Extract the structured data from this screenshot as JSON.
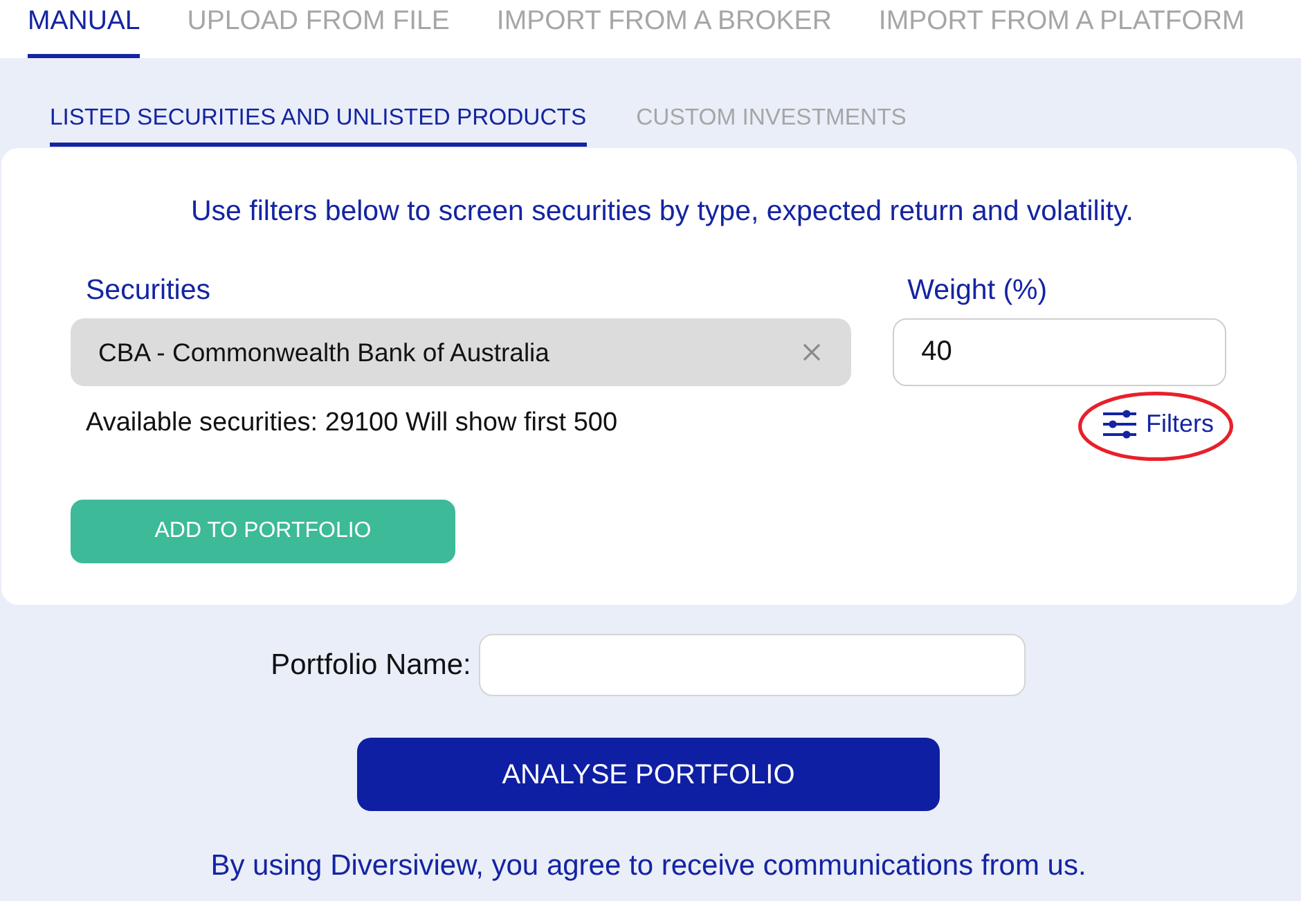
{
  "tabs": [
    {
      "label": "MANUAL",
      "selected": true
    },
    {
      "label": "UPLOAD FROM FILE",
      "selected": false
    },
    {
      "label": "IMPORT FROM A BROKER",
      "selected": false
    },
    {
      "label": "IMPORT FROM A PLATFORM",
      "selected": false
    }
  ],
  "subtabs": [
    {
      "label": "LISTED SECURITIES AND UNLISTED PRODUCTS",
      "selected": true
    },
    {
      "label": "CUSTOM INVESTMENTS",
      "selected": false
    }
  ],
  "card": {
    "intro": "Use filters below to screen securities by type, expected return and volatility.",
    "securities": {
      "label": "Securities",
      "value": "CBA - Commonwealth Bank of Australia"
    },
    "weight": {
      "label": "Weight (%)",
      "value": "40"
    },
    "availability": "Available securities: 29100 Will show first 500",
    "filters": {
      "label": "Filters",
      "highlighted": true
    },
    "add_button": "ADD TO PORTFOLIO"
  },
  "portfolio_name": {
    "label": "Portfolio Name:"
  },
  "analyse_button": "ANALYSE PORTFOLIO",
  "footer": "By using Diversiview, you agree to receive communications from us."
}
